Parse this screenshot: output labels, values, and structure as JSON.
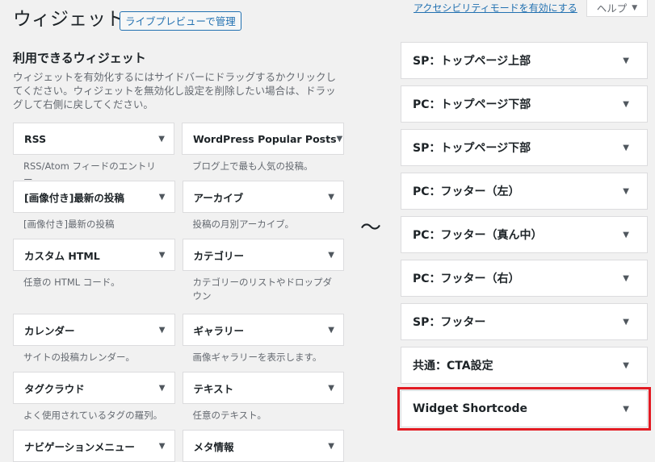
{
  "header": {
    "title": "ウィジェット",
    "manage_button": "ライブプレビューで管理",
    "accessibility_link": "アクセシビリティモードを有効にする",
    "help_tab": "ヘルプ"
  },
  "available": {
    "title": "利用できるウィジェット",
    "description": "ウィジェットを有効化するにはサイドバーにドラッグするかクリックしてください。ウィジェットを無効化し設定を削除したい場合は、ドラッグして右側に戻してください。",
    "widgets": [
      {
        "name": "RSS",
        "desc": "RSS/Atom フィードのエントリー"
      },
      {
        "name": "WordPress Popular Posts",
        "desc": "ブログ上で最も人気の投稿。"
      },
      {
        "name": "[画像付き]最新の投稿",
        "desc": "[画像付き]最新の投稿"
      },
      {
        "name": "アーカイブ",
        "desc": "投稿の月別アーカイブ。"
      },
      {
        "name": "カスタム HTML",
        "desc": "任意の HTML コード。"
      },
      {
        "name": "カテゴリー",
        "desc": "カテゴリーのリストやドロップダウン"
      },
      {
        "name": "カレンダー",
        "desc": "サイトの投稿カレンダー。"
      },
      {
        "name": "ギャラリー",
        "desc": "画像ギャラリーを表示します。"
      },
      {
        "name": "タグクラウド",
        "desc": "よく使用されているタグの羅列。"
      },
      {
        "name": "テキスト",
        "desc": "任意のテキスト。"
      },
      {
        "name": "ナビゲーションメニュー",
        "desc": ""
      },
      {
        "name": "メタ情報",
        "desc": ""
      }
    ]
  },
  "separator": "〜",
  "sidebars": [
    {
      "name": "SP：トップページ上部"
    },
    {
      "name": "PC：トップページ下部"
    },
    {
      "name": "SP：トップページ下部"
    },
    {
      "name": "PC：フッター（左）"
    },
    {
      "name": "PC：フッター（真ん中）"
    },
    {
      "name": "PC：フッター（右）"
    },
    {
      "name": "SP：フッター"
    },
    {
      "name": "共通：CTA設定"
    },
    {
      "name": "Widget Shortcode"
    }
  ],
  "icons": {
    "toggle": "▼"
  },
  "colors": {
    "highlight": "#e21b23",
    "link": "#2271b1"
  }
}
